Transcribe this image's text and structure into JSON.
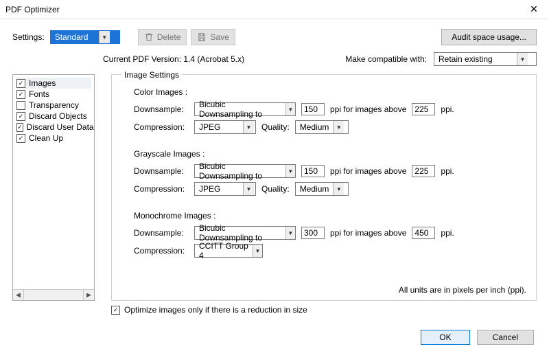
{
  "window": {
    "title": "PDF Optimizer"
  },
  "toolbar": {
    "settings_label": "Settings:",
    "settings_value": "Standard",
    "delete_label": "Delete",
    "save_label": "Save",
    "audit_label": "Audit space usage..."
  },
  "meta": {
    "version": "Current PDF Version: 1.4 (Acrobat 5.x)",
    "compat_label": "Make compatible with:",
    "compat_value": "Retain existing"
  },
  "sidebar": {
    "items": [
      {
        "label": "Images",
        "checked": true,
        "selected": true
      },
      {
        "label": "Fonts",
        "checked": true,
        "selected": false
      },
      {
        "label": "Transparency",
        "checked": false,
        "selected": false
      },
      {
        "label": "Discard Objects",
        "checked": true,
        "selected": false
      },
      {
        "label": "Discard User Data",
        "checked": true,
        "selected": false
      },
      {
        "label": "Clean Up",
        "checked": true,
        "selected": false
      }
    ]
  },
  "panel": {
    "title": "Image Settings",
    "labels": {
      "downsample": "Downsample:",
      "compression": "Compression:",
      "quality": "Quality:",
      "ppi_above": "ppi for images above",
      "ppi": "ppi."
    },
    "sections": {
      "color": {
        "heading": "Color Images :",
        "downsample": "Bicubic Downsampling to",
        "ppi": "150",
        "above": "225",
        "compression": "JPEG",
        "quality": "Medium"
      },
      "gray": {
        "heading": "Grayscale Images :",
        "downsample": "Bicubic Downsampling to",
        "ppi": "150",
        "above": "225",
        "compression": "JPEG",
        "quality": "Medium"
      },
      "mono": {
        "heading": "Monochrome Images :",
        "downsample": "Bicubic Downsampling to",
        "ppi": "300",
        "above": "450",
        "compression": "CCITT Group 4"
      }
    },
    "footnote": "All units are in pixels per inch (ppi)."
  },
  "below": {
    "optimize_label": "Optimize images only if there is a reduction in size",
    "optimize_checked": true
  },
  "buttons": {
    "ok": "OK",
    "cancel": "Cancel"
  }
}
